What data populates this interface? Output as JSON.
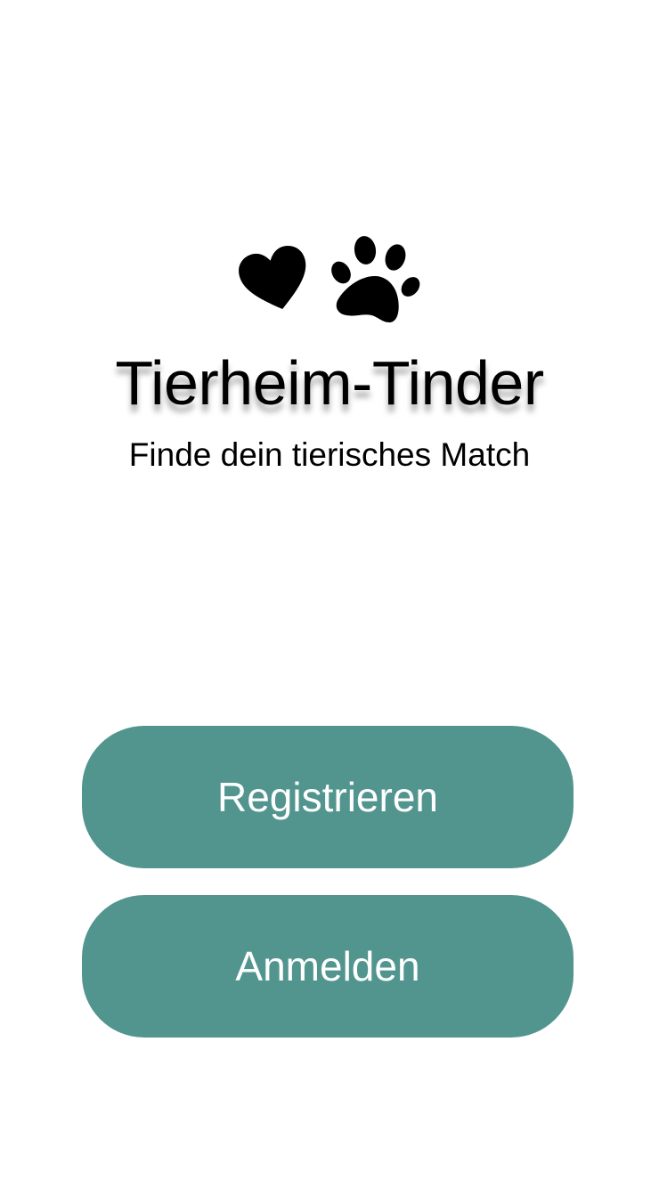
{
  "app": {
    "title": "Tierheim-Tinder",
    "subtitle": "Finde dein tierisches Match"
  },
  "logo": {
    "icons": [
      "heart-icon",
      "paw-icon"
    ],
    "color": "#000000"
  },
  "actions": {
    "register_label": "Registrieren",
    "login_label": "Anmelden"
  },
  "theme": {
    "accent": "#52958F",
    "button_text": "#FFFFFF",
    "background": "#FFFFFF"
  }
}
